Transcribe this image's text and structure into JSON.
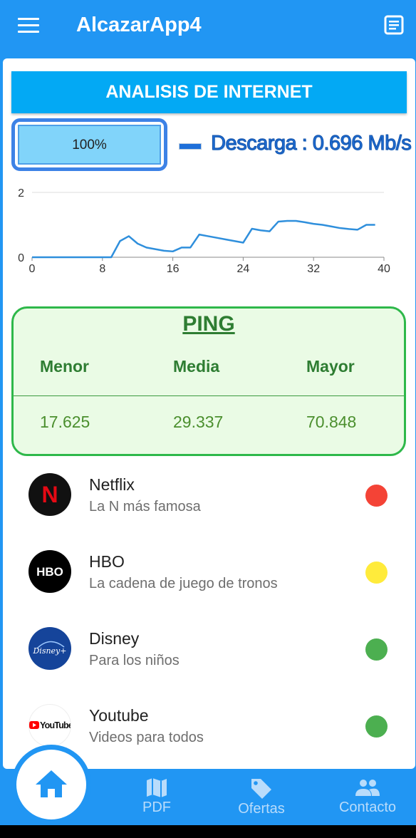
{
  "appbar": {
    "title": "AlcazarApp4",
    "menu_icon": "menu-icon",
    "doc_icon": "description-icon"
  },
  "banner": {
    "label": "ANALISIS DE INTERNET"
  },
  "progress": {
    "value_label": "100%",
    "fraction": 1.0
  },
  "download": {
    "label": "Descarga : 0.696 Mb/s"
  },
  "chart_data": {
    "type": "line",
    "x": [
      0,
      1,
      2,
      3,
      4,
      5,
      6,
      7,
      8,
      9,
      10,
      11,
      12,
      13,
      14,
      15,
      16,
      17,
      18,
      19,
      20,
      21,
      22,
      23,
      24,
      25,
      26,
      27,
      28,
      29,
      30,
      31,
      32,
      33,
      34,
      35,
      36,
      37,
      38,
      39,
      40
    ],
    "series": [
      {
        "values": [
          0,
          0,
          0,
          0,
          0,
          0,
          0,
          0,
          0,
          0,
          0.5,
          0.65,
          0.42,
          0.3,
          0.25,
          0.2,
          0.18,
          0.3,
          0.3,
          0.7,
          0.65,
          0.6,
          0.55,
          0.5,
          0.45,
          0.88,
          0.83,
          0.8,
          1.1,
          1.12,
          1.12,
          1.08,
          1.03,
          1.0,
          0.95,
          0.9,
          0.87,
          0.85,
          1.0,
          1.0,
          null
        ]
      }
    ],
    "xlim": [
      0,
      40
    ],
    "ylim": [
      0,
      2
    ],
    "xticks": [
      "0",
      "8",
      "16",
      "24",
      "32",
      "40"
    ],
    "yticks": [
      "0",
      "2"
    ],
    "grid": "horizontal",
    "color": "#2f8fdc"
  },
  "ping": {
    "title": "PING",
    "headers": [
      "Menor",
      "Media",
      "Mayor"
    ],
    "values": [
      "17.625",
      "29.337",
      "70.848"
    ]
  },
  "services": [
    {
      "title": "Netflix",
      "subtitle": "La N más famosa",
      "logo_text": "N",
      "logo_icon": "netflix-logo",
      "status_color": "#f44336"
    },
    {
      "title": "HBO",
      "subtitle": "La cadena de juego de tronos",
      "logo_text": "HBO",
      "logo_icon": "hbo-logo",
      "status_color": "#ffeb3b"
    },
    {
      "title": "Disney",
      "subtitle": "Para los niños",
      "logo_text": "Disney+",
      "logo_icon": "disney-logo",
      "status_color": "#4caf50"
    },
    {
      "title": "Youtube",
      "subtitle": "Videos para todos",
      "logo_text": "YouTube",
      "logo_icon": "youtube-logo",
      "status_color": "#4caf50"
    }
  ],
  "bottomnav": {
    "home_icon": "home-icon",
    "items": [
      {
        "label": "PDF",
        "icon": "map-icon"
      },
      {
        "label": "Ofertas",
        "icon": "tag-icon"
      },
      {
        "label": "Contacto",
        "icon": "people-icon"
      }
    ]
  }
}
